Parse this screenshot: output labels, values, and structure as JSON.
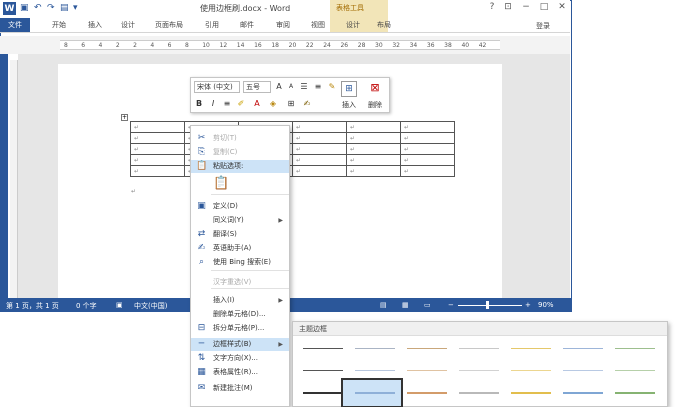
{
  "window": {
    "title": "使用边框刷.docx - Word",
    "context_group": "表格工具",
    "account": "登录",
    "help": "?",
    "restore": "⊡",
    "minimize": "−",
    "maximize": "□",
    "close": "✕"
  },
  "tabs": [
    "文件",
    "开始",
    "插入",
    "设计",
    "页面布局",
    "引用",
    "邮件",
    "审阅",
    "视图",
    "设计",
    "布局"
  ],
  "ruler_ticks": [
    "8",
    "6",
    "4",
    "2",
    "2",
    "4",
    "6",
    "8",
    "10",
    "12",
    "14",
    "16",
    "18",
    "20",
    "22",
    "24",
    "26",
    "28",
    "30",
    "32",
    "34",
    "36",
    "38",
    "40",
    "42"
  ],
  "mini_toolbar": {
    "font": "宋体 (中文)",
    "size": "五号",
    "grow": "A",
    "shrink": "A",
    "bold": "B",
    "italic": "I",
    "insert_label": "插入",
    "delete_label": "删除"
  },
  "table": {
    "rows": 5,
    "cols": 6,
    "cell_mark": "↵"
  },
  "context_menu": [
    {
      "label": "剪切(T)",
      "icon": "scissors-icon",
      "disabled": true
    },
    {
      "label": "复制(C)",
      "icon": "copy-icon",
      "disabled": true
    },
    {
      "label": "粘贴选项:",
      "icon": "paste-icon",
      "disabled": false,
      "highlight": true
    },
    {
      "label": "定义(D)",
      "icon": "define-icon"
    },
    {
      "label": "同义词(Y)",
      "icon": "",
      "submenu": true
    },
    {
      "label": "翻译(S)",
      "icon": "translate-icon"
    },
    {
      "label": "英语助手(A)",
      "icon": "english-assistant-icon"
    },
    {
      "label": "使用 Bing 搜索(E)",
      "icon": "bing-search-icon"
    },
    {
      "label": "汉字重选(V)",
      "icon": "",
      "disabled": true
    },
    {
      "label": "插入(I)",
      "icon": "",
      "submenu": true
    },
    {
      "label": "删除单元格(D)...",
      "icon": ""
    },
    {
      "label": "拆分单元格(P)...",
      "icon": "split-cells-icon"
    },
    {
      "label": "边框样式(B)",
      "icon": "border-style-icon",
      "submenu": true,
      "hover": true
    },
    {
      "label": "文字方向(X)...",
      "icon": "text-direction-icon"
    },
    {
      "label": "表格属性(R)...",
      "icon": "table-properties-icon"
    },
    {
      "label": "新建批注(M)",
      "icon": "new-comment-icon"
    }
  ],
  "gallery": {
    "header": "主题边框",
    "row_colors": [
      [
        "#555555",
        "#aab4c4",
        "#c9a77b",
        "#c8c8c8",
        "#e5c86a",
        "#9db5d9",
        "#9dbf8e"
      ],
      [
        "#555555",
        "#b7c6dd",
        "#e0c3a2",
        "#d2d2d2",
        "#ecd690",
        "#b8c9e3",
        "#b6d0a9"
      ],
      [
        "#333333",
        "#8fb0d8",
        "#d39c6a",
        "#b9b9b9",
        "#e2be4d",
        "#7fa6d4",
        "#86b372"
      ]
    ]
  },
  "status": {
    "page": "第 1 页，共 1 页",
    "words": "0 个字",
    "lang": "中文(中国)",
    "zoom": "90%"
  }
}
